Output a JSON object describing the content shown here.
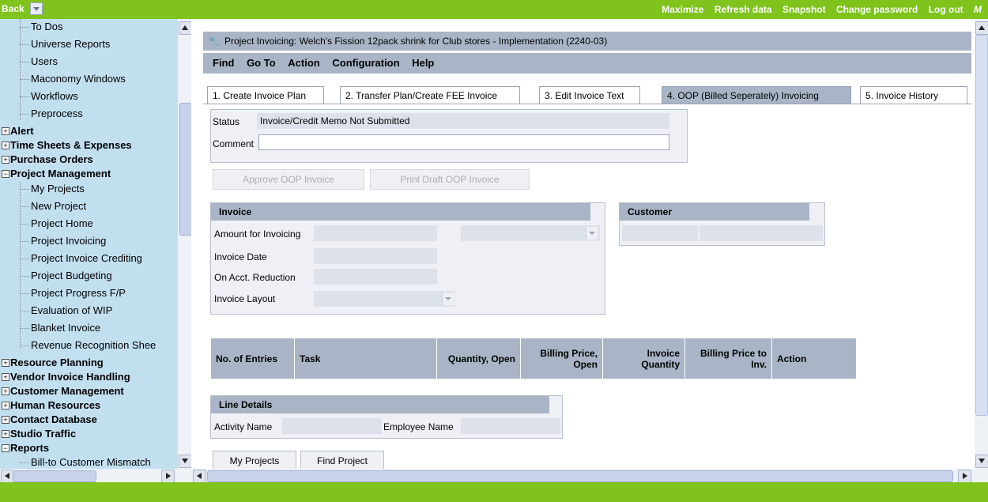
{
  "topbar": {
    "back_label": "Back",
    "links": [
      "Maximize",
      "Refresh data",
      "Snapshot",
      "Change password",
      "Log out",
      "M"
    ]
  },
  "tree": {
    "items_top": [
      "To Dos",
      "Universe Reports",
      "Users",
      "Maconomy Windows",
      "Workflows",
      "Preprocess"
    ],
    "groups_a": [
      "Alert",
      "Time Sheets & Expenses",
      "Purchase Orders",
      "Project Management"
    ],
    "pm_items": [
      "My Projects",
      "New Project",
      "Project Home",
      "Project Invoicing",
      "Project Invoice Crediting",
      "Project Budgeting",
      "Project Progress F/P",
      "Evaluation of WIP",
      "Blanket Invoice",
      "Revenue Recognition Shee"
    ],
    "groups_b": [
      "Resource Planning",
      "Vendor Invoice Handling",
      "Customer Management",
      "Human Resources",
      "Contact Database",
      "Studio Traffic",
      "Reports"
    ],
    "reports_items": [
      "Bill-to Customer Mismatch"
    ]
  },
  "window": {
    "title": "Project Invoicing: Welch's Fission 12pack shrink for Club stores - Implementation (2240-03)"
  },
  "menu": [
    "Find",
    "Go To",
    "Action",
    "Configuration",
    "Help"
  ],
  "tabs": [
    "1. Create Invoice Plan",
    "2. Transfer Plan/Create FEE Invoice",
    "3. Edit Invoice Text",
    "4. OOP (Billed Seperately) Invoicing",
    "5. Invoice History"
  ],
  "status": {
    "status_label": "Status",
    "status_value": "Invoice/Credit Memo Not Submitted",
    "comment_label": "Comment",
    "comment_value": ""
  },
  "actions": {
    "approve": "Approve OOP Invoice",
    "print": "Print Draft OOP Invoice"
  },
  "invoice_panel": {
    "title": "Invoice",
    "amount_label": "Amount for Invoicing",
    "date_label": "Invoice Date",
    "reduction_label": "On Acct. Reduction",
    "layout_label": "Invoice Layout"
  },
  "customer_panel": {
    "title": "Customer"
  },
  "table": {
    "headers": [
      "No. of Entries",
      "Task",
      "Quantity, Open",
      "Billing Price, Open",
      "Invoice Quantity",
      "Billing Price to Inv.",
      "Action"
    ]
  },
  "line_details": {
    "title": "Line Details",
    "activity_label": "Activity Name",
    "employee_label": "Employee Name"
  },
  "footer_buttons": {
    "my_projects": "My Projects",
    "find_project": "Find Project"
  }
}
